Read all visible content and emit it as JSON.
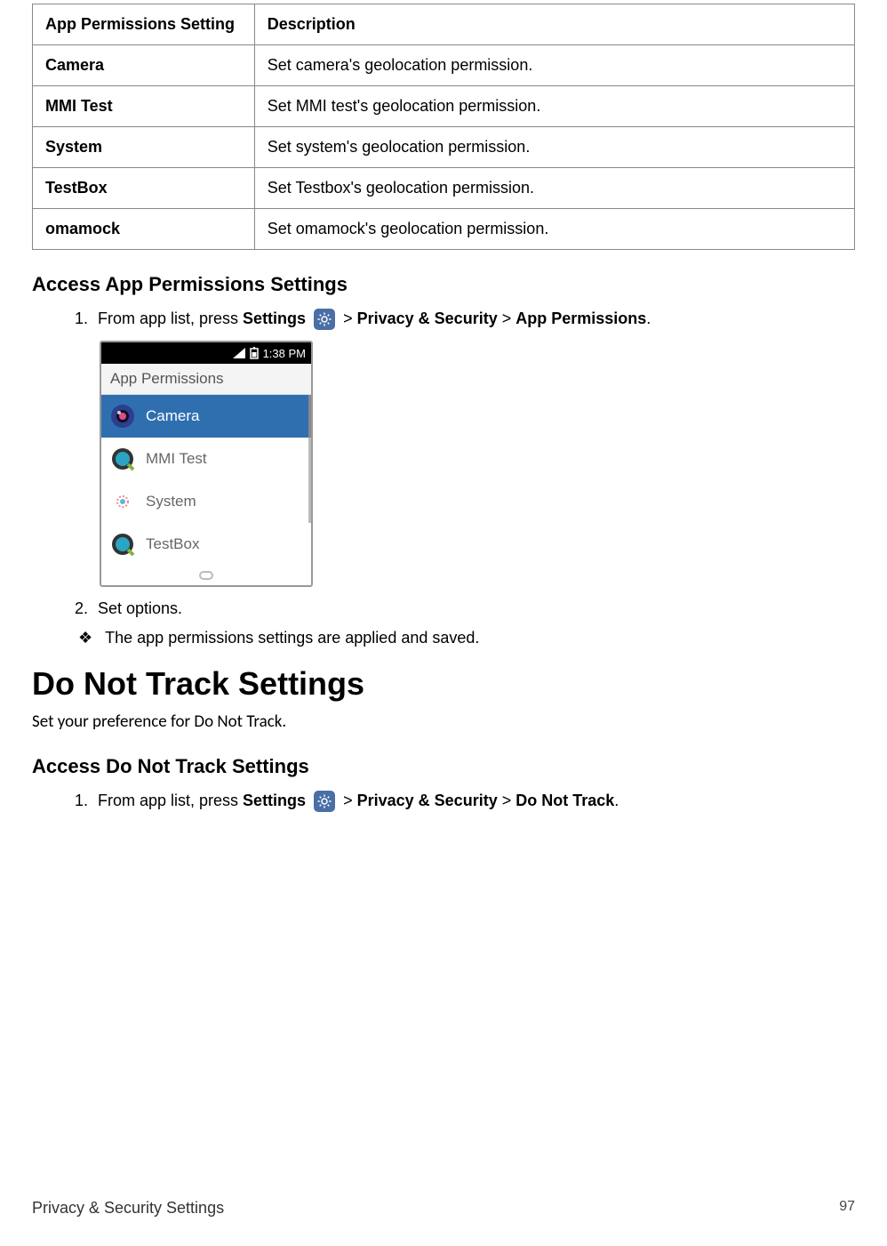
{
  "table": {
    "header_left": "App Permissions Setting",
    "header_right": "Description",
    "rows": [
      {
        "name": "Camera",
        "desc": "Set camera's geolocation permission."
      },
      {
        "name": "MMI Test",
        "desc": "Set MMI test's geolocation permission."
      },
      {
        "name": "System",
        "desc": "Set system's geolocation permission."
      },
      {
        "name": "TestBox",
        "desc": "Set Testbox's geolocation permission."
      },
      {
        "name": "omamock",
        "desc": "Set omamock's geolocation permission."
      }
    ]
  },
  "section1": {
    "heading": "Access App Permissions Settings",
    "step1_prefix": "From app list, press ",
    "settings": "Settings",
    "gt": " > ",
    "privacy": "Privacy & Security",
    "app_perm": "App Permissions",
    "period": ".",
    "step2": "Set options.",
    "result": "The app permissions settings are applied and saved."
  },
  "phone": {
    "time": "1:38 PM",
    "header": "App Permissions",
    "items": [
      {
        "label": "Camera",
        "selected": true
      },
      {
        "label": "MMI Test",
        "selected": false
      },
      {
        "label": "System",
        "selected": false
      },
      {
        "label": "TestBox",
        "selected": false
      }
    ]
  },
  "section2": {
    "h1": "Do Not Track Settings",
    "intro": "Set your preference for Do Not Track.",
    "heading": "Access Do Not Track Settings",
    "step1_prefix": "From app list, press ",
    "settings": "Settings",
    "gt": " > ",
    "privacy": "Privacy & Security",
    "dnt": "Do Not Track",
    "period": "."
  },
  "footer": {
    "left": "Privacy & Security Settings",
    "right": "97"
  },
  "bullet_glyph": "❖"
}
